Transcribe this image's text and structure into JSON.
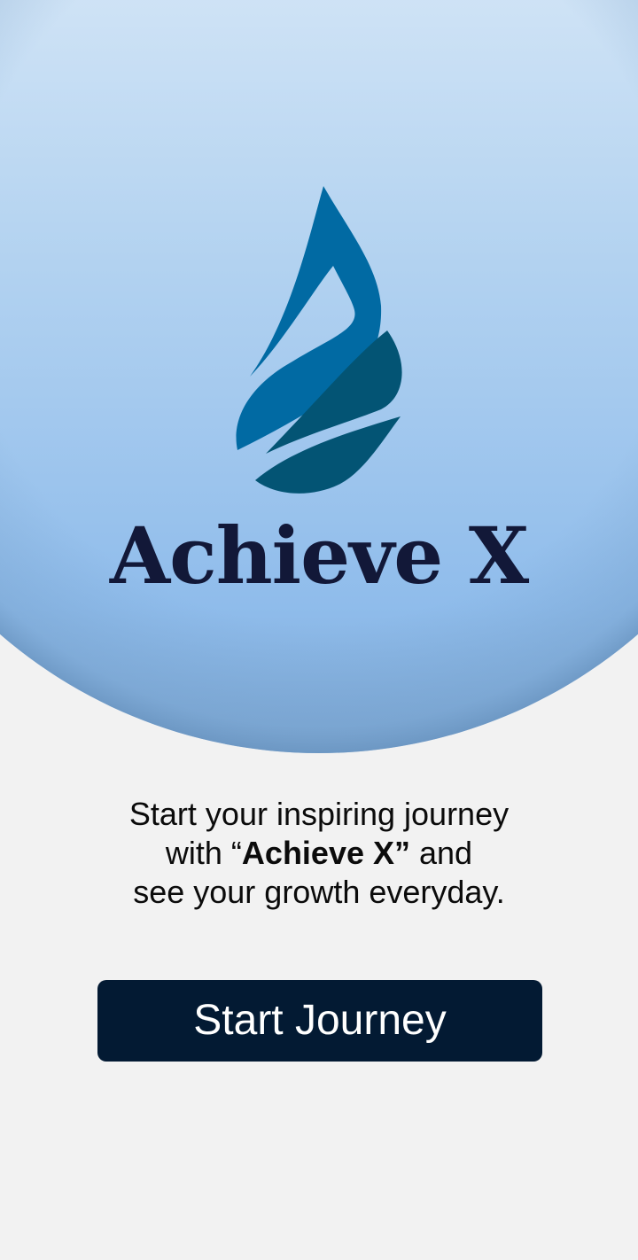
{
  "brand": {
    "name": "Achieve X",
    "logo_icon": "water-drop-leaves-icon",
    "colors": {
      "drop_primary": "#016aa3",
      "drop_dark": "#035474",
      "wordmark": "#121838"
    }
  },
  "hero": {
    "gradient_top": "#e5eff9",
    "gradient_bottom": "#8ebbea",
    "edge_shadow": "#6e98c2"
  },
  "tagline": {
    "line1": "Start your inspiring journey",
    "line2_prefix": "with “",
    "line2_bold": "Achieve X”",
    "line2_suffix": " and",
    "line3": "see your growth everyday."
  },
  "cta": {
    "label": "Start Journey",
    "background": "#031a33"
  }
}
